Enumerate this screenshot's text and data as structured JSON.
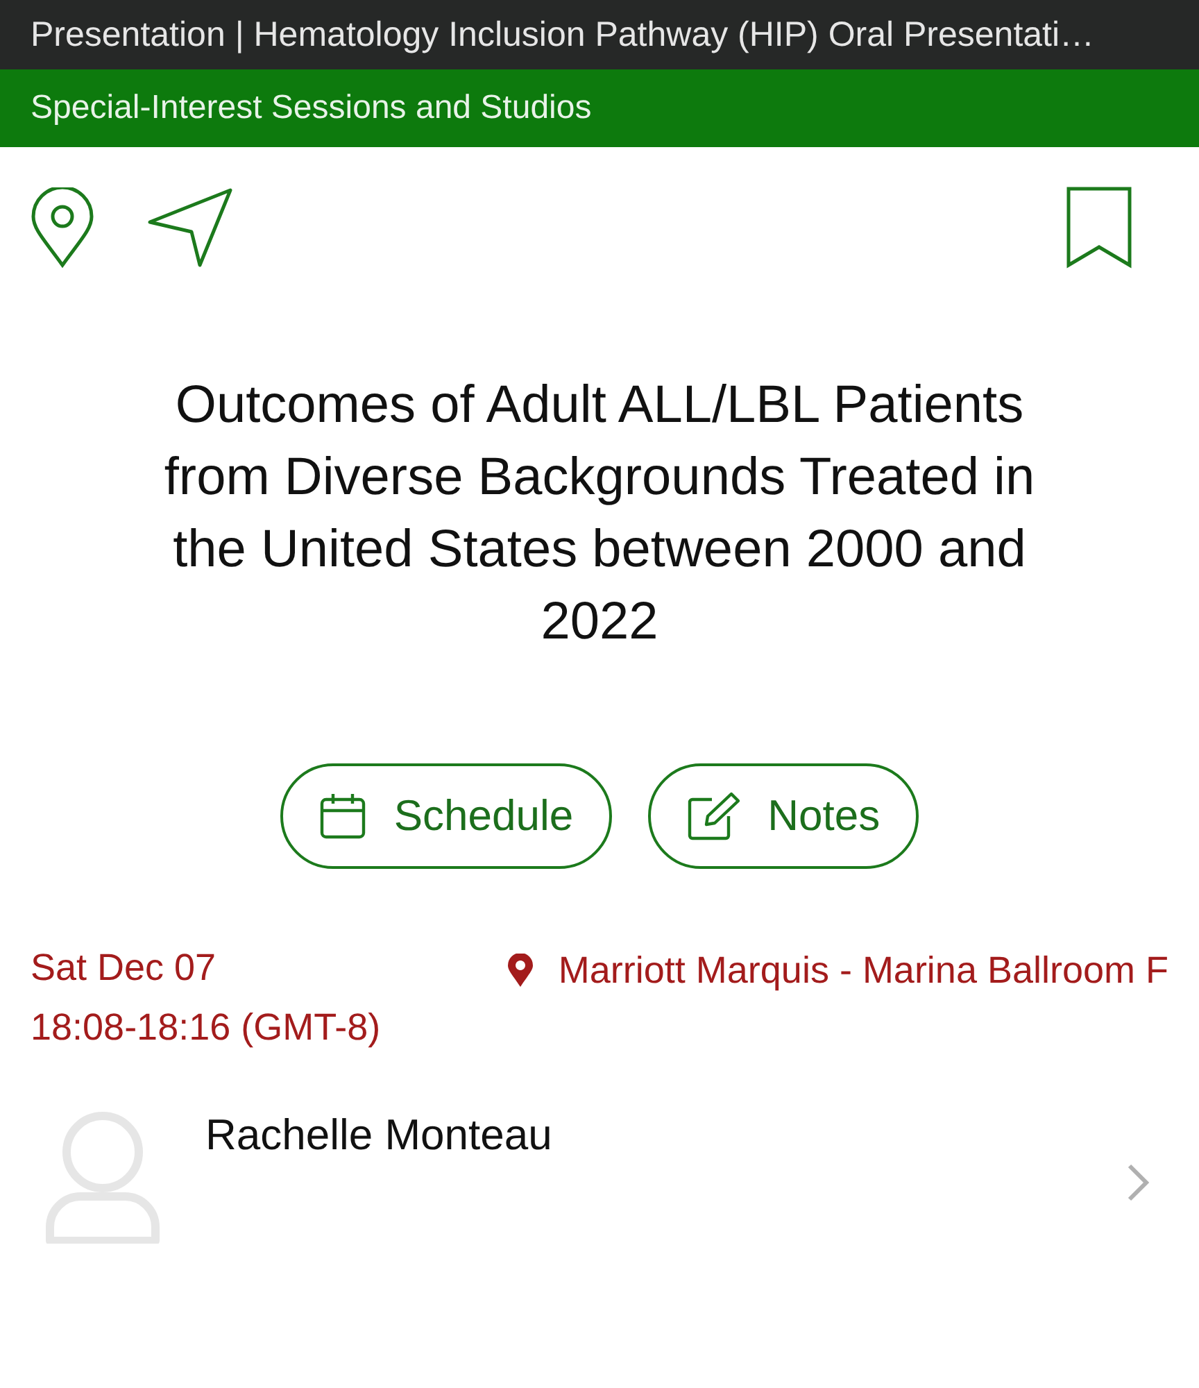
{
  "header": {
    "title": "Presentation | Hematology Inclusion Pathway (HIP) Oral Presentati…"
  },
  "session_bar": {
    "label": "Special-Interest Sessions and Studios"
  },
  "bookmark": {
    "selected": false
  },
  "title": "Outcomes of Adult ALL/LBL Patients from Diverse Backgrounds Treated in the United States between 2000 and 2022",
  "buttons": [
    {
      "kind": "calendar",
      "label": "Schedule"
    },
    {
      "kind": "notes",
      "label": "Notes"
    }
  ],
  "date": "Sat Dec 07",
  "time": "18:08-18:16 (GMT-8)",
  "location": "Marriott Marquis - Marina Ballroom F",
  "speakers": [
    {
      "name": "Rachelle Monteau"
    }
  ]
}
